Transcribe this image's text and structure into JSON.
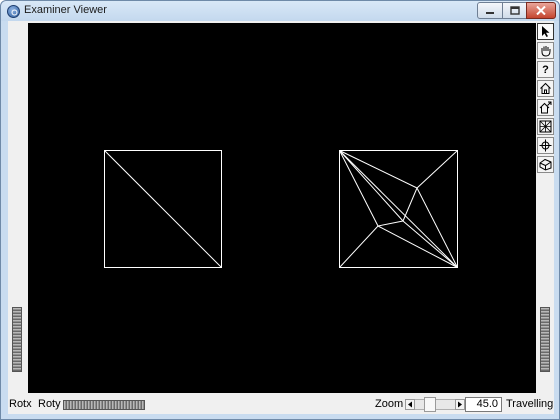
{
  "window": {
    "title": "Examiner Viewer"
  },
  "viewport": {
    "background": "#000000",
    "line_color": "#ffffff"
  },
  "toolbar": {
    "tools": [
      {
        "name": "select-pointer-icon",
        "active": true
      },
      {
        "name": "hand-view-icon",
        "active": false
      },
      {
        "name": "help-icon",
        "label": "?",
        "active": false
      },
      {
        "name": "home-icon",
        "active": false
      },
      {
        "name": "set-home-icon",
        "active": false
      },
      {
        "name": "view-all-icon",
        "active": false
      },
      {
        "name": "seek-icon",
        "active": false
      },
      {
        "name": "projection-icon",
        "active": false
      }
    ]
  },
  "bottom_bar": {
    "rotx_label": "Rotx",
    "roty_label": "Roty",
    "zoom_label": "Zoom",
    "zoom_value": "45.0",
    "mode_label": "Travelling"
  }
}
